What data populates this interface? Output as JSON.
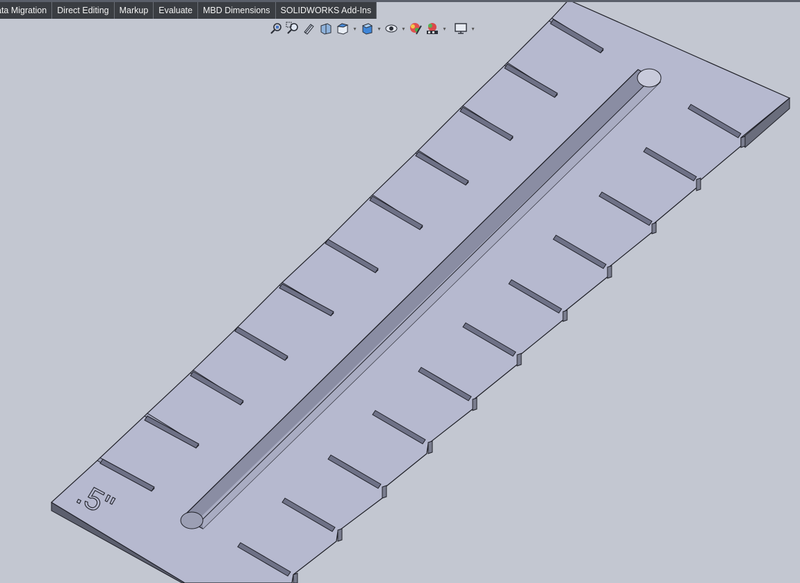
{
  "tabs": [
    {
      "label": "Data Migration",
      "display": "ata Migration"
    },
    {
      "label": "Direct Editing",
      "display": "Direct Editing"
    },
    {
      "label": "Markup",
      "display": "Markup"
    },
    {
      "label": "Evaluate",
      "display": "Evaluate"
    },
    {
      "label": "MBD Dimensions",
      "display": "MBD Dimensions"
    },
    {
      "label": "SOLIDWORKS Add-Ins",
      "display": "SOLIDWORKS Add-Ins"
    }
  ],
  "heads_up_toolbar": [
    {
      "icon": "zoom-to-fit-icon"
    },
    {
      "icon": "zoom-to-area-icon"
    },
    {
      "icon": "previous-view-icon"
    },
    {
      "icon": "section-view-icon"
    },
    {
      "icon": "view-orientation-icon",
      "dropdown": true
    },
    {
      "icon": "display-style-icon",
      "dropdown": true
    },
    {
      "icon": "hide-show-items-icon",
      "dropdown": true
    },
    {
      "icon": "edit-appearance-icon"
    },
    {
      "icon": "apply-scene-icon",
      "dropdown": true
    },
    {
      "icon": "view-settings-icon",
      "dropdown": true
    }
  ],
  "model": {
    "engraved_label": ".5\""
  },
  "colors": {
    "background": "#c3c7d1",
    "tab_background": "#3a3d42",
    "tab_text": "#f2f2f2",
    "part_face": "#b6b9cf",
    "part_side": "#5c5f6e",
    "edge": "#1e1f26"
  }
}
